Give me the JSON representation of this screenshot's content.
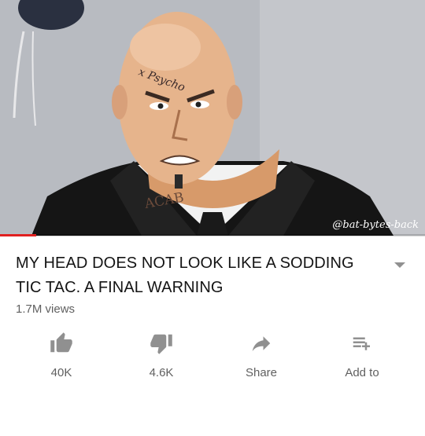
{
  "video": {
    "watermark": "@bat-bytes-back",
    "progress": 0.085
  },
  "title": "MY HEAD DOES NOT LOOK LIKE A SODDING TIC TAC. A FINAL WARNING",
  "views": "1.7M views",
  "actions": {
    "like": {
      "label": "40K",
      "icon": "thumbs-up-icon"
    },
    "dislike": {
      "label": "4.6K",
      "icon": "thumbs-down-icon"
    },
    "share": {
      "label": "Share",
      "icon": "share-arrow-icon"
    },
    "add_to": {
      "label": "Add to",
      "icon": "playlist-add-icon"
    }
  },
  "colors": {
    "progress": "#e02020",
    "icon": "#909090",
    "text_secondary": "#606060"
  }
}
